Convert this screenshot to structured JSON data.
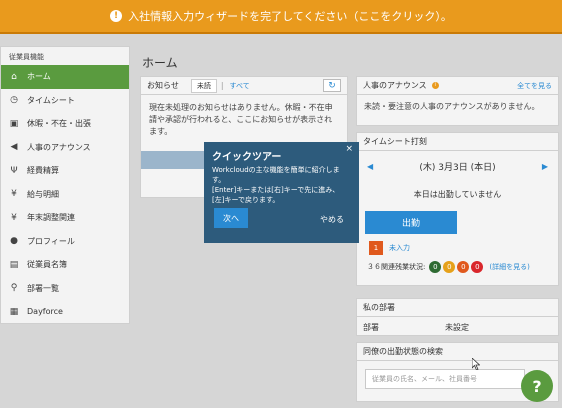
{
  "banner": {
    "icon": "info-icon",
    "text": "入社情報入力ウィザードを完了してください（ここをクリック）。"
  },
  "sidebar": {
    "heading": "従業員機能",
    "items": [
      {
        "label": "ホーム",
        "icon": "home-icon",
        "glyph": "⌂",
        "active": true
      },
      {
        "label": "タイムシート",
        "icon": "clock-icon",
        "glyph": "◷"
      },
      {
        "label": "休暇・不在・出張",
        "icon": "calendar-icon",
        "glyph": "▣"
      },
      {
        "label": "人事のアナウンス",
        "icon": "megaphone-icon",
        "glyph": "◀"
      },
      {
        "label": "経費精算",
        "icon": "food-icon",
        "glyph": "Ψ"
      },
      {
        "label": "給与明細",
        "icon": "yen-icon",
        "glyph": "¥"
      },
      {
        "label": "年末調整関連",
        "icon": "yen-icon",
        "glyph": "¥"
      },
      {
        "label": "プロフィール",
        "icon": "user-icon",
        "glyph": "●"
      },
      {
        "label": "従業員名簿",
        "icon": "book-icon",
        "glyph": "▤"
      },
      {
        "label": "部署一覧",
        "icon": "org-chart-icon",
        "glyph": "⚲"
      },
      {
        "label": "Dayforce",
        "icon": "calendar-grid-icon",
        "glyph": "▦"
      }
    ]
  },
  "main": {
    "title": "ホーム"
  },
  "notice": {
    "title": "お知らせ",
    "tab_unread": "未読",
    "separator": "|",
    "tab_all": "すべて",
    "body": "現在未処理のお知らせはありません。休暇・不在申請や承認が行われると、ここにお知らせが表示されます。"
  },
  "announcements": {
    "title": "人事のアナウンス",
    "see_all": "全てを見る",
    "body": "未読・要注意の人事のアナウンスがありません。"
  },
  "timesheet": {
    "title": "タイムシート打刻",
    "prev": "◀",
    "next": "▶",
    "date": "(木) 3月3日  (本日)",
    "status": "本日は出勤していません",
    "clock_in": "出勤",
    "unentered_count": "1",
    "unentered_label": "未入力",
    "overtime_label": "３６関連残業状況:",
    "overtime_counts": [
      "0",
      "0",
      "0",
      "0"
    ],
    "overtime_colors": [
      "#2f6b33",
      "#e6a11a",
      "#e0591d",
      "#d9262b"
    ],
    "detail_link": "(詳細を見る)"
  },
  "department": {
    "title": "私の部署",
    "label": "部署",
    "value": "未設定"
  },
  "colleague_search": {
    "title": "同僚の出勤状態の検索",
    "placeholder": "従業員の氏名、メール、社員番号"
  },
  "help": {
    "label": "?"
  },
  "tour": {
    "close": "×",
    "title": "クイックツアー",
    "body1": "Workcloudの主な機能を簡単に紹介します。",
    "body2": "[Enter]キーまたは[右]キーで先に進み、[左]キーで戻ります。",
    "next": "次へ",
    "skip": "やめる"
  }
}
